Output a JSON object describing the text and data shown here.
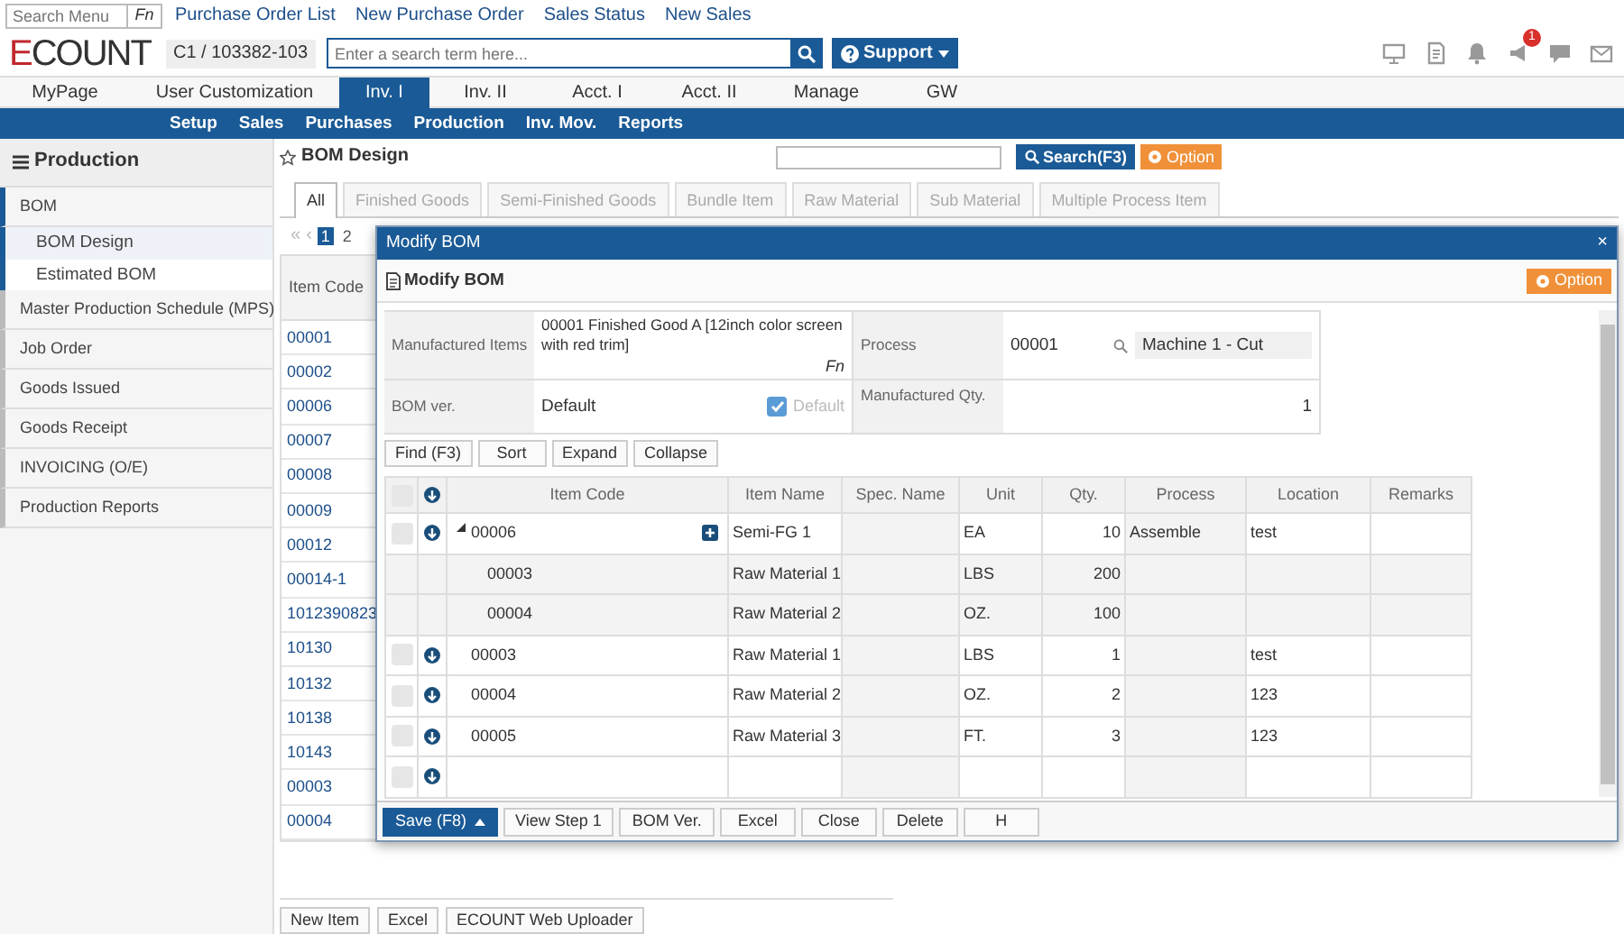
{
  "top_links": {
    "search_menu": {
      "placeholder": "Search Menu"
    },
    "fn": "Fn",
    "links": [
      "Purchase Order List",
      "New Purchase Order",
      "Sales Status",
      "New Sales"
    ]
  },
  "header": {
    "logo": "ECOUNT",
    "company": "C1 / 103382-103",
    "search": {
      "placeholder": "Enter a search term here..."
    },
    "support": "Support",
    "notification_badge": "1"
  },
  "main_menu": [
    {
      "label": "MyPage",
      "selected": false
    },
    {
      "label": "User Customization",
      "selected": false
    },
    {
      "label": "Inv. I",
      "selected": true
    },
    {
      "label": "Inv. II",
      "selected": false
    },
    {
      "label": "Acct. I",
      "selected": false
    },
    {
      "label": "Acct. II",
      "selected": false
    },
    {
      "label": "Manage",
      "selected": false
    },
    {
      "label": "GW",
      "selected": false
    }
  ],
  "sub_menu": [
    "Setup",
    "Sales",
    "Purchases",
    "Production",
    "Inv. Mov.",
    "Reports"
  ],
  "sidebar": {
    "title": "Production",
    "items": [
      {
        "label": "BOM",
        "selected": true,
        "children": [
          {
            "label": "BOM Design",
            "selected": true
          },
          {
            "label": "Estimated BOM",
            "selected": false
          }
        ]
      },
      {
        "label": "Master Production Schedule (MPS)",
        "selected": false
      },
      {
        "label": "Job Order",
        "selected": false
      },
      {
        "label": "Goods Issued",
        "selected": false
      },
      {
        "label": "Goods Receipt",
        "selected": false
      },
      {
        "label": "INVOICING (O/E)",
        "selected": false
      },
      {
        "label": "Production Reports",
        "selected": false
      }
    ]
  },
  "bom_design": {
    "title": "BOM Design",
    "search_button": "Search(F3)",
    "option_button": "Option",
    "tabs": [
      {
        "label": "All",
        "selected": true
      },
      {
        "label": "Finished Goods",
        "selected": false
      },
      {
        "label": "Semi-Finished Goods",
        "selected": false
      },
      {
        "label": "Bundle Item",
        "selected": false
      },
      {
        "label": "Raw Material",
        "selected": false
      },
      {
        "label": "Sub Material",
        "selected": false
      },
      {
        "label": "Multiple Process Item",
        "selected": false
      }
    ],
    "pager": {
      "first": "«",
      "prev": "‹",
      "pages": [
        {
          "label": "1",
          "selected": true
        },
        {
          "label": "2",
          "selected": false
        }
      ]
    },
    "column": "Item Code",
    "rows": [
      "00001",
      "00002",
      "00006",
      "00007",
      "00008",
      "00009",
      "00012",
      "00014-1",
      "1012390823",
      "10130",
      "10132",
      "10138",
      "10143",
      "00003",
      "00004"
    ],
    "buttons": [
      "New Item",
      "Excel",
      "ECOUNT Web Uploader"
    ]
  },
  "modal": {
    "title": "Modify BOM",
    "close": "×",
    "heading": "Modify BOM",
    "option_button": "Option",
    "form": {
      "manufactured_items_label": "Manufactured Items",
      "manufactured_items": "00001 Finished Good A [12inch color screen with red trim]",
      "fn": "Fn",
      "process_label": "Process",
      "process_code": "00001",
      "process_name": "Machine 1 - Cut",
      "bom_ver_label": "BOM ver.",
      "bom_ver": "Default",
      "default_label": "Default",
      "default_checked": true,
      "qty_label": "Manufactured Qty.",
      "qty": "1"
    },
    "toolbar": [
      "Find (F3)",
      "Sort",
      "Expand",
      "Collapse"
    ],
    "select_all_checked": false,
    "columns": [
      "Item Code",
      "Item Name",
      "Spec. Name",
      "Unit",
      "Qty.",
      "Process",
      "Location",
      "Remarks"
    ],
    "rows": [
      {
        "kind": "item",
        "checked": false,
        "code": "00006",
        "name": "Semi-FG 1",
        "unit": "EA",
        "qty": "10",
        "process": "Assemble",
        "location": "test",
        "expanded": true,
        "children": [
          {
            "kind": "item",
            "code": "00003",
            "name": "Raw Material 1",
            "unit": "LBS",
            "qty": "200"
          },
          {
            "kind": "item",
            "code": "00004",
            "name": "Raw Material 2",
            "unit": "OZ.",
            "qty": "100"
          }
        ]
      },
      {
        "kind": "item",
        "checked": false,
        "code": "00003",
        "name": "Raw Material 1",
        "unit": "LBS",
        "qty": "1",
        "location": "test"
      },
      {
        "kind": "item",
        "checked": false,
        "code": "00004",
        "name": "Raw Material 2",
        "unit": "OZ.",
        "qty": "2",
        "location": "123"
      },
      {
        "kind": "item",
        "checked": false,
        "code": "00005",
        "name": "Raw Material 3",
        "unit": "FT.",
        "qty": "3",
        "location": "123"
      },
      {
        "kind": "new",
        "checked": false
      }
    ],
    "footer_buttons": [
      {
        "label": "Save (F8)",
        "kind": "primary"
      },
      {
        "label": "View Step 1",
        "kind": "plain"
      },
      {
        "label": "BOM Ver.",
        "kind": "plain"
      },
      {
        "label": "Excel",
        "kind": "plain"
      },
      {
        "label": "Close",
        "kind": "plain"
      },
      {
        "label": "Delete",
        "kind": "plain"
      },
      {
        "label": "H",
        "kind": "plain"
      }
    ]
  }
}
